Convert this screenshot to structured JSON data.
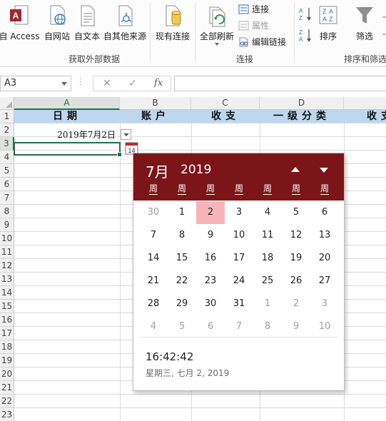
{
  "ribbon": {
    "buttons": {
      "access": "自 Access",
      "web": "自网站",
      "text": "自文本",
      "other": "自其他来源",
      "existing": "现有连接",
      "refresh_all": "全部刷新",
      "sort": "排序",
      "filter": "筛选"
    },
    "connections": {
      "connect": "连接",
      "properties": "属性",
      "edit_links": "编辑链接"
    },
    "groups": {
      "external": "获取外部数据",
      "connections": "连接",
      "sortfilter": "排序和筛选"
    }
  },
  "formula_bar": {
    "name_box": "A3",
    "cancel": "✕",
    "enter": "✓",
    "fx": "fx",
    "value": ""
  },
  "sheet": {
    "columns": [
      "A",
      "B",
      "C",
      "D"
    ],
    "rows": [
      "1",
      "2",
      "3",
      "4",
      "5",
      "6",
      "7",
      "8",
      "9",
      "10",
      "11",
      "12",
      "13",
      "14",
      "15",
      "16",
      "17",
      "18",
      "19",
      "20",
      "21",
      "22",
      "23"
    ],
    "header_row": [
      "日期",
      "账户",
      "收支",
      "一级分类",
      "收支"
    ],
    "a2_value": "2019年7月2日",
    "active_cell": "A3"
  },
  "date_picker": {
    "month": "7月",
    "year": "2019",
    "weekdays": [
      "周",
      "周",
      "周",
      "周",
      "周",
      "周",
      "周"
    ],
    "weeks": [
      [
        {
          "d": "30",
          "dim": true
        },
        {
          "d": "1"
        },
        {
          "d": "2",
          "sel": true
        },
        {
          "d": "3"
        },
        {
          "d": "4"
        },
        {
          "d": "5"
        },
        {
          "d": "6"
        }
      ],
      [
        {
          "d": "7"
        },
        {
          "d": "8"
        },
        {
          "d": "9"
        },
        {
          "d": "10"
        },
        {
          "d": "11"
        },
        {
          "d": "12"
        },
        {
          "d": "13"
        }
      ],
      [
        {
          "d": "14"
        },
        {
          "d": "15"
        },
        {
          "d": "16"
        },
        {
          "d": "17"
        },
        {
          "d": "18"
        },
        {
          "d": "19"
        },
        {
          "d": "20"
        }
      ],
      [
        {
          "d": "21"
        },
        {
          "d": "22"
        },
        {
          "d": "23"
        },
        {
          "d": "24"
        },
        {
          "d": "25"
        },
        {
          "d": "26"
        },
        {
          "d": "27"
        }
      ],
      [
        {
          "d": "28"
        },
        {
          "d": "29"
        },
        {
          "d": "30"
        },
        {
          "d": "31"
        },
        {
          "d": "1",
          "dim": true
        },
        {
          "d": "2",
          "dim": true
        },
        {
          "d": "3",
          "dim": true
        }
      ],
      [
        {
          "d": "4",
          "dim": true
        },
        {
          "d": "5",
          "dim": true
        },
        {
          "d": "6",
          "dim": true
        },
        {
          "d": "7",
          "dim": true
        },
        {
          "d": "8",
          "dim": true
        },
        {
          "d": "9",
          "dim": true
        },
        {
          "d": "10",
          "dim": true
        }
      ]
    ],
    "time": "16:42:42",
    "full_date": "星期三, 七月 2, 2019"
  },
  "colors": {
    "picker_header": "#7b1517",
    "selected_day": "#f5b5b8",
    "header_band": "#bdd7ee",
    "excel_green": "#217346"
  }
}
